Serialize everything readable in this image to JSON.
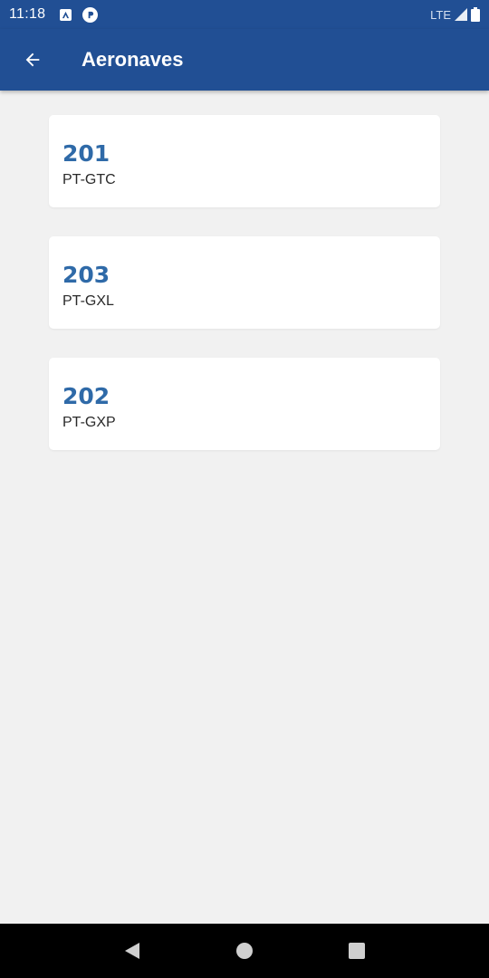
{
  "status_bar": {
    "time": "11:18",
    "network": "LTE",
    "icons": [
      "notification-a-icon",
      "notification-p-icon",
      "signal-icon",
      "battery-icon"
    ]
  },
  "app_bar": {
    "title": "Aeronaves",
    "back_icon": "arrow-back-icon",
    "background_color": "#214f94"
  },
  "aircraft": [
    {
      "number": "201",
      "registration": "PT-GTC"
    },
    {
      "number": "203",
      "registration": "PT-GXL"
    },
    {
      "number": "202",
      "registration": "PT-GXP"
    }
  ],
  "colors": {
    "primary": "#214f94",
    "accent_text": "#2f6aa8",
    "background": "#f1f1f1"
  },
  "nav_bar": {
    "buttons": [
      "back-triangle-icon",
      "home-circle-icon",
      "recents-square-icon"
    ]
  }
}
